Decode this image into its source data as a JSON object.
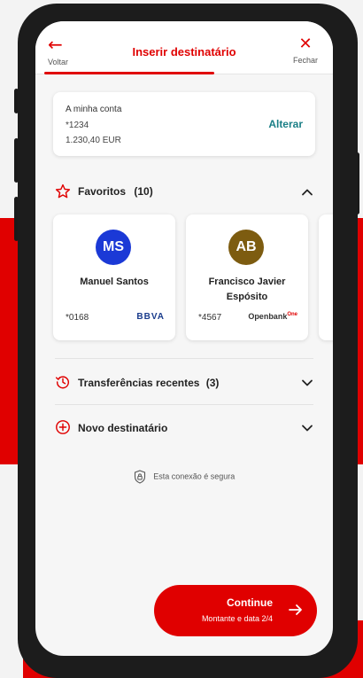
{
  "header": {
    "back_label": "Voltar",
    "title": "Inserir destinatário",
    "close_label": "Fechar"
  },
  "account": {
    "name": "A minha conta",
    "number": "*1234",
    "balance": "1.230,40 EUR",
    "change_label": "Alterar"
  },
  "favorites": {
    "title": "Favoritos",
    "count": "(10)",
    "items": [
      {
        "initials": "MS",
        "name": "Manuel Santos",
        "account": "*0168",
        "bank": "BBVA",
        "avatar_color": "#1b39d6",
        "bank_color": "#1a3c8c"
      },
      {
        "initials": "AB",
        "name": "Francisco Javier Espósito",
        "account": "*4567",
        "bank": "Openbank",
        "bank_sup": "One",
        "avatar_color": "#7d5c10",
        "bank_color": "#333333"
      }
    ]
  },
  "recent": {
    "title": "Transferências recentes",
    "count": "(3)"
  },
  "new_recipient": {
    "title": "Novo destinatário"
  },
  "security": {
    "text": "Esta conexão é segura"
  },
  "continue": {
    "label": "Continue",
    "sub": "Montante e data 2/4"
  },
  "colors": {
    "brand": "#e00000",
    "accent_link": "#1a7f86"
  }
}
